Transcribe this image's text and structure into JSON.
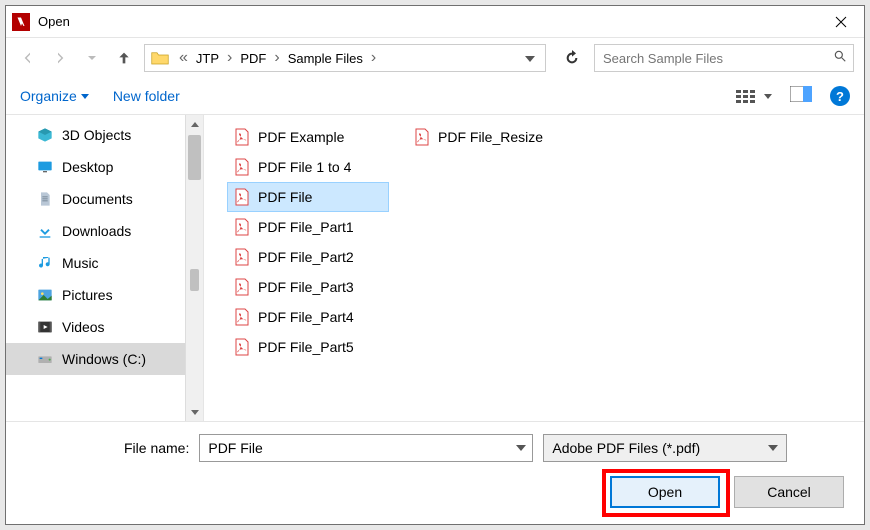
{
  "title": "Open",
  "breadcrumb": {
    "prefix": "«",
    "parts": [
      "JTP",
      "PDF",
      "Sample Files"
    ]
  },
  "search": {
    "placeholder": "Search Sample Files"
  },
  "toolbar": {
    "organize": "Organize",
    "new_folder": "New folder"
  },
  "sidebar": {
    "items": [
      {
        "label": "3D Objects",
        "icon": "3d"
      },
      {
        "label": "Desktop",
        "icon": "desktop"
      },
      {
        "label": "Documents",
        "icon": "documents"
      },
      {
        "label": "Downloads",
        "icon": "downloads"
      },
      {
        "label": "Music",
        "icon": "music"
      },
      {
        "label": "Pictures",
        "icon": "pictures"
      },
      {
        "label": "Videos",
        "icon": "videos"
      },
      {
        "label": "Windows (C:)",
        "icon": "drive",
        "selected": true
      }
    ]
  },
  "files": {
    "col1": [
      {
        "label": "PDF Example"
      },
      {
        "label": "PDF File 1 to 4"
      },
      {
        "label": "PDF File",
        "selected": true
      },
      {
        "label": "PDF File_Part1"
      },
      {
        "label": "PDF File_Part2"
      },
      {
        "label": "PDF File_Part3"
      },
      {
        "label": "PDF File_Part4"
      },
      {
        "label": "PDF File_Part5"
      }
    ],
    "col2": [
      {
        "label": "PDF File_Resize"
      }
    ]
  },
  "bottom": {
    "filename_label": "File name:",
    "filename_value": "PDF File",
    "filter": "Adobe PDF Files (*.pdf)",
    "open": "Open",
    "cancel": "Cancel"
  }
}
